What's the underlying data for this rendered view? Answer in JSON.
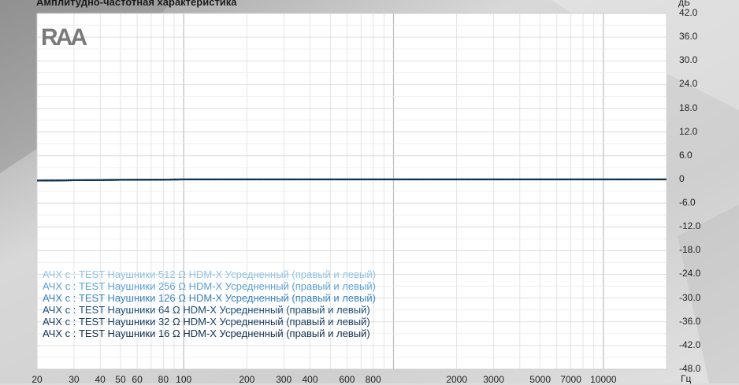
{
  "chart_data": {
    "type": "line",
    "title": "Амплитудно-частотная характеристика",
    "ylabel": "дБ",
    "xlabel": "Гц",
    "xscale": "log",
    "xlim": [
      20,
      20000
    ],
    "ylim": [
      -48,
      42
    ],
    "grid": true,
    "legend_position": "bottom-left",
    "y_ticks": [
      "42.0",
      "36.0",
      "30.0",
      "24.0",
      "18.0",
      "12.0",
      "6.0",
      "0",
      "-6.0",
      "-12.0",
      "-18.0",
      "-24.0",
      "-30.0",
      "-36.0",
      "-42.0",
      "-48.0"
    ],
    "x_ticks": [
      {
        "value": 20,
        "label": "20"
      },
      {
        "value": 30,
        "label": "30"
      },
      {
        "value": 40,
        "label": "40"
      },
      {
        "value": 50,
        "label": "50"
      },
      {
        "value": 60,
        "label": "60"
      },
      {
        "value": 80,
        "label": "80"
      },
      {
        "value": 100,
        "label": "100"
      },
      {
        "value": 200,
        "label": "200"
      },
      {
        "value": 300,
        "label": "300"
      },
      {
        "value": 400,
        "label": "400"
      },
      {
        "value": 600,
        "label": "600"
      },
      {
        "value": 800,
        "label": "800"
      },
      {
        "value": 2000,
        "label": "2000"
      },
      {
        "value": 3000,
        "label": "3000"
      },
      {
        "value": 5000,
        "label": "5000"
      },
      {
        "value": 7000,
        "label": "7000"
      },
      {
        "value": 10000,
        "label": "10000"
      }
    ],
    "x": [
      20,
      30,
      50,
      100,
      200,
      500,
      1000,
      2000,
      5000,
      10000,
      20000
    ],
    "series": [
      {
        "name": "АЧХ с : TEST Наушники 512 Ω HDM-X Усредненный (правый и левый)",
        "color": "#8fc3e6",
        "values": [
          -0.3,
          -0.2,
          -0.1,
          0.0,
          0.0,
          0.0,
          0.0,
          0.0,
          0.0,
          0.0,
          0.0
        ]
      },
      {
        "name": "АЧХ с : TEST Наушники 256 Ω HDM-X Усредненный (правый и левый)",
        "color": "#5fa3d6",
        "values": [
          -0.3,
          -0.2,
          -0.1,
          0.0,
          0.0,
          0.0,
          0.0,
          0.0,
          0.0,
          0.0,
          0.0
        ]
      },
      {
        "name": "АЧХ с : TEST Наушники 126 Ω HDM-X Усредненный (правый и левый)",
        "color": "#3a84bf",
        "values": [
          -0.3,
          -0.2,
          -0.1,
          0.0,
          0.0,
          0.0,
          0.0,
          0.0,
          0.0,
          0.0,
          0.0
        ]
      },
      {
        "name": "АЧХ с : TEST Наушники 64 Ω HDM-X Усредненный (правый и левый)",
        "color": "#1d4f78",
        "values": [
          -0.3,
          -0.2,
          -0.1,
          0.0,
          0.0,
          0.0,
          0.0,
          0.0,
          0.0,
          0.0,
          0.0
        ]
      },
      {
        "name": "АЧХ с : TEST Наушники 32 Ω HDM-X Усредненный (правый и левый)",
        "color": "#173d5e",
        "values": [
          -0.3,
          -0.2,
          -0.1,
          0.0,
          0.0,
          0.0,
          0.0,
          0.0,
          0.0,
          0.0,
          0.0
        ]
      },
      {
        "name": "АЧХ с : TEST Наушники 16 Ω HDM-X Усредненный (правый и левый)",
        "color": "#12314c",
        "values": [
          -0.3,
          -0.2,
          -0.1,
          0.0,
          0.0,
          0.0,
          0.0,
          0.0,
          0.0,
          0.0,
          0.0
        ]
      }
    ]
  },
  "logo": {
    "text": "RAA"
  }
}
